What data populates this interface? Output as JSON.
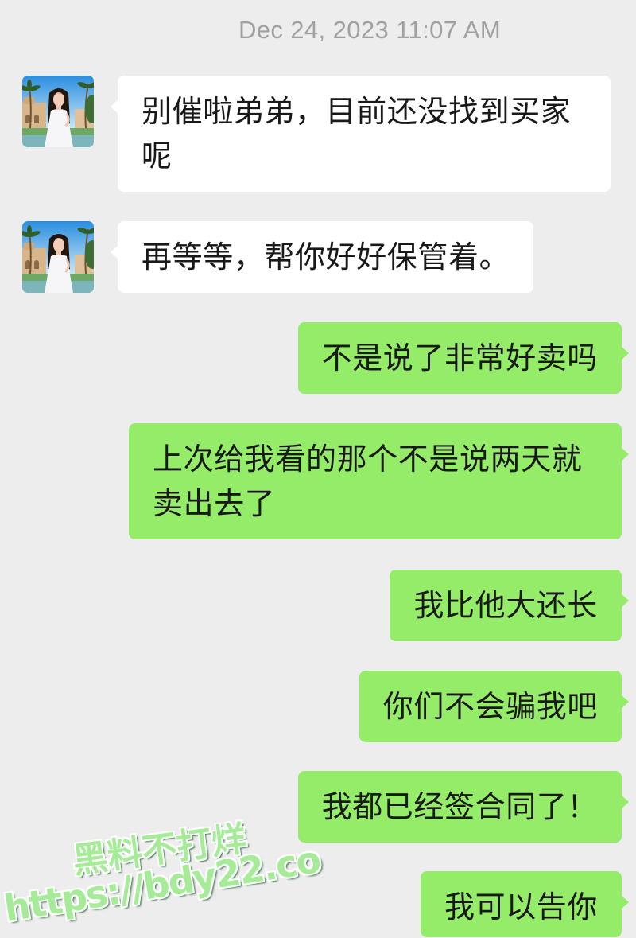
{
  "timestamp": "Dec 24, 2023 11:07 AM",
  "contact": {
    "avatar_icon": "woman-portrait-avatar"
  },
  "messages": [
    {
      "outgoing": false,
      "text": "别催啦弟弟，目前还没找到买家呢"
    },
    {
      "outgoing": false,
      "text": "再等等，帮你好好保管着。"
    },
    {
      "outgoing": true,
      "text": "不是说了非常好卖吗"
    },
    {
      "outgoing": true,
      "text": "上次给我看的那个不是说两天就卖出去了"
    },
    {
      "outgoing": true,
      "text": "我比他大还长"
    },
    {
      "outgoing": true,
      "text": "你们不会骗我吧"
    },
    {
      "outgoing": true,
      "text": "我都已经签合同了！"
    },
    {
      "outgoing": true,
      "text": "我可以告你"
    }
  ],
  "watermark": {
    "line1": "黑料不打烊",
    "line2": "https://bdy22.co"
  },
  "colors": {
    "background": "#ededed",
    "incoming_bubble": "#ffffff",
    "outgoing_bubble": "#95ec69",
    "message_text": "#191919",
    "timestamp_text": "#a0a0a0",
    "watermark_fill": "#a6ec98"
  }
}
